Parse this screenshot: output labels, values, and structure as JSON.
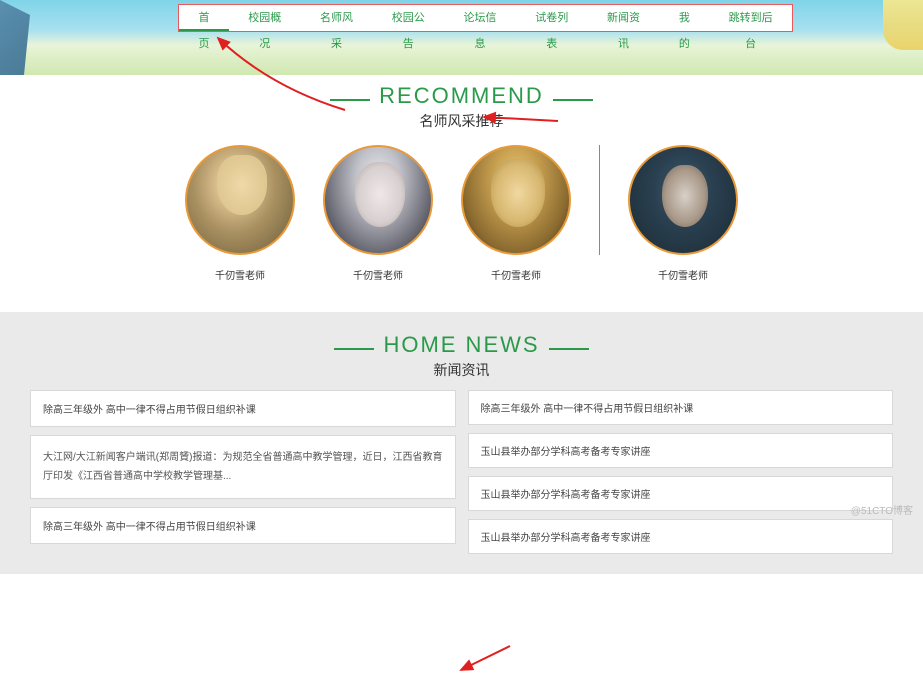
{
  "nav": {
    "items": [
      {
        "label": "首页",
        "active": true
      },
      {
        "label": "校园概况"
      },
      {
        "label": "名师风采"
      },
      {
        "label": "校园公告"
      },
      {
        "label": "论坛信息"
      },
      {
        "label": "试卷列表"
      },
      {
        "label": "新闻资讯"
      },
      {
        "label": "我的"
      },
      {
        "label": "跳转到后台"
      }
    ]
  },
  "recommend": {
    "title_en": "RECOMMEND",
    "title_cn": "名师风采推荐",
    "teachers": [
      {
        "name": "千仞雪老师"
      },
      {
        "name": "千仞雪老师"
      },
      {
        "name": "千仞雪老师"
      },
      {
        "name": "千仞雪老师"
      }
    ]
  },
  "news": {
    "title_en": "HOME NEWS",
    "title_cn": "新闻资讯",
    "left": [
      {
        "title": "除高三年级外 高中一律不得占用节假日组织补课"
      },
      {
        "content": "大江网/大江新闻客户端讯(郑周贇)报道：为规范全省普通高中教学管理，近日，江西省教育厅印发《江西省普通高中学校教学管理基..."
      },
      {
        "title": "除高三年级外 高中一律不得占用节假日组织补课"
      }
    ],
    "right": [
      {
        "title": "除高三年级外 高中一律不得占用节假日组织补课"
      },
      {
        "title": "玉山县举办部分学科高考备考专家讲座"
      },
      {
        "title": "玉山县举办部分学科高考备考专家讲座"
      },
      {
        "title": "玉山县举办部分学科高考备考专家讲座"
      }
    ]
  },
  "watermark": "@51CTO博客"
}
